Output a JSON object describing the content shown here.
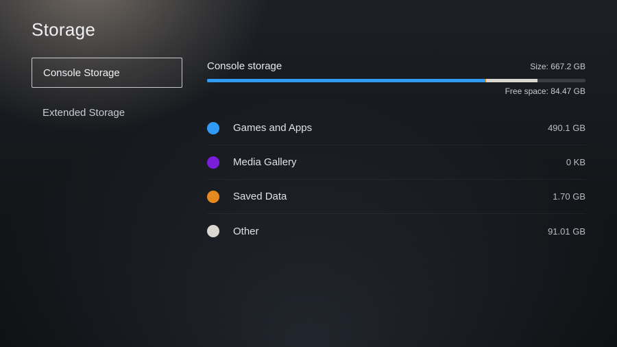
{
  "page_title": "Storage",
  "sidebar": {
    "items": [
      {
        "label": "Console Storage",
        "selected": true
      },
      {
        "label": "Extended Storage",
        "selected": false
      }
    ]
  },
  "main": {
    "section_title": "Console storage",
    "size_prefix": "Size:",
    "size_value": "667.2 GB",
    "free_prefix": "Free space:",
    "free_value": "84.47 GB",
    "bar": {
      "segments": [
        {
          "name": "games-apps",
          "color": "#2f9bf4",
          "start_pct": 0.0,
          "width_pct": 73.5
        },
        {
          "name": "media-gallery",
          "color": "#7a1edb",
          "start_pct": 73.5,
          "width_pct": 0.0
        },
        {
          "name": "saved-data",
          "color": "#e68a1f",
          "start_pct": 73.5,
          "width_pct": 0.3
        },
        {
          "name": "other",
          "color": "#d9d7d0",
          "start_pct": 73.8,
          "width_pct": 13.6
        }
      ]
    },
    "categories": [
      {
        "label": "Games and Apps",
        "value": "490.1 GB",
        "color": "#2f9bf4"
      },
      {
        "label": "Media Gallery",
        "value": "0 KB",
        "color": "#7a1edb"
      },
      {
        "label": "Saved Data",
        "value": "1.70 GB",
        "color": "#e68a1f"
      },
      {
        "label": "Other",
        "value": "91.01 GB",
        "color": "#d9d7d0"
      }
    ]
  }
}
